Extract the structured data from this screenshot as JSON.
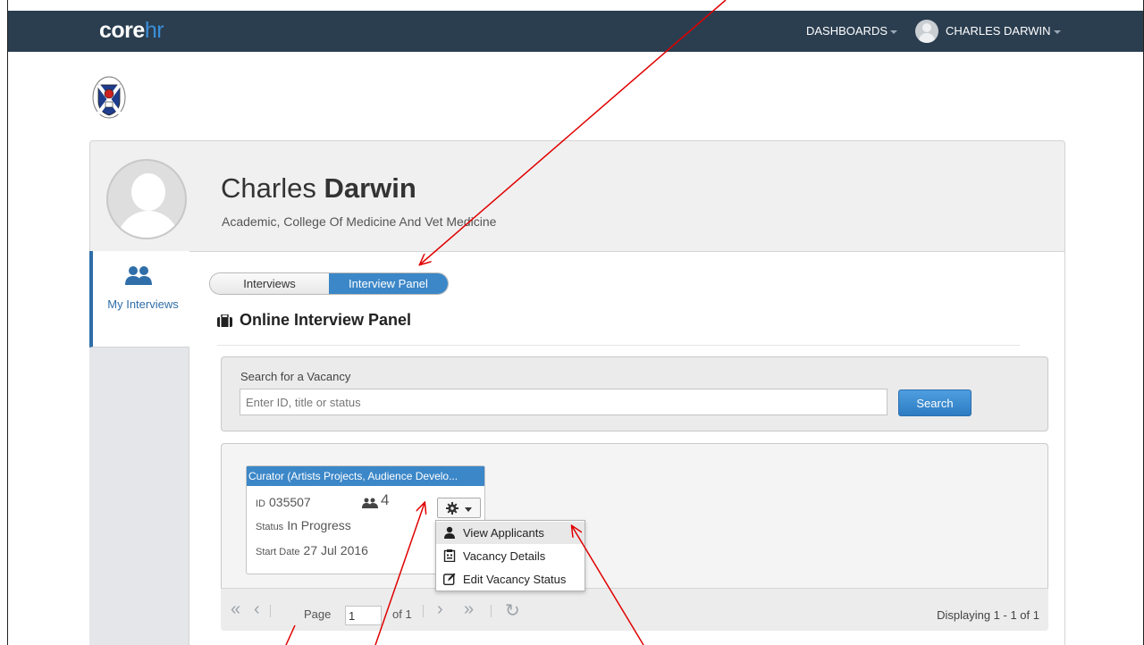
{
  "topbar": {
    "logo_main": "core",
    "logo_accent": "hr",
    "dashboards_label": "DASHBOARDS",
    "user_label": "CHARLES DARWIN",
    "bg_color": "#2b3e50",
    "accent_color": "#3b87c8"
  },
  "profile": {
    "first_name": "Charles",
    "last_name": "Darwin",
    "role": "Academic, College Of Medicine And Vet Medicine"
  },
  "sidebar": {
    "item_label": "My Interviews",
    "item_icon": "users-icon"
  },
  "tabs": {
    "interviews": "Interviews",
    "panel": "Interview Panel",
    "active": "Interview Panel"
  },
  "section_title": "Online Interview Panel",
  "search": {
    "label": "Search for a Vacancy",
    "placeholder": "Enter ID, title or status",
    "value": "",
    "button": "Search"
  },
  "vacancy": {
    "title": "Curator (Artists Projects, Audience Develo...",
    "id_label": "ID",
    "id_value": "035507",
    "applicant_count": "4",
    "status_label": "Status",
    "status_value": "In Progress",
    "start_label": "Start Date",
    "start_value": "27 Jul 2016"
  },
  "menu": {
    "items": [
      {
        "label": "View Applicants",
        "icon": "user-icon"
      },
      {
        "label": "Vacancy Details",
        "icon": "clipboard-icon"
      },
      {
        "label": "Edit Vacancy Status",
        "icon": "edit-icon"
      }
    ]
  },
  "pager": {
    "page_label": "Page",
    "page_value": "1",
    "of_label": "of 1",
    "display_text": "Displaying 1 - 1 of 1"
  },
  "annotation": {
    "arrow_color": "#e00000"
  }
}
